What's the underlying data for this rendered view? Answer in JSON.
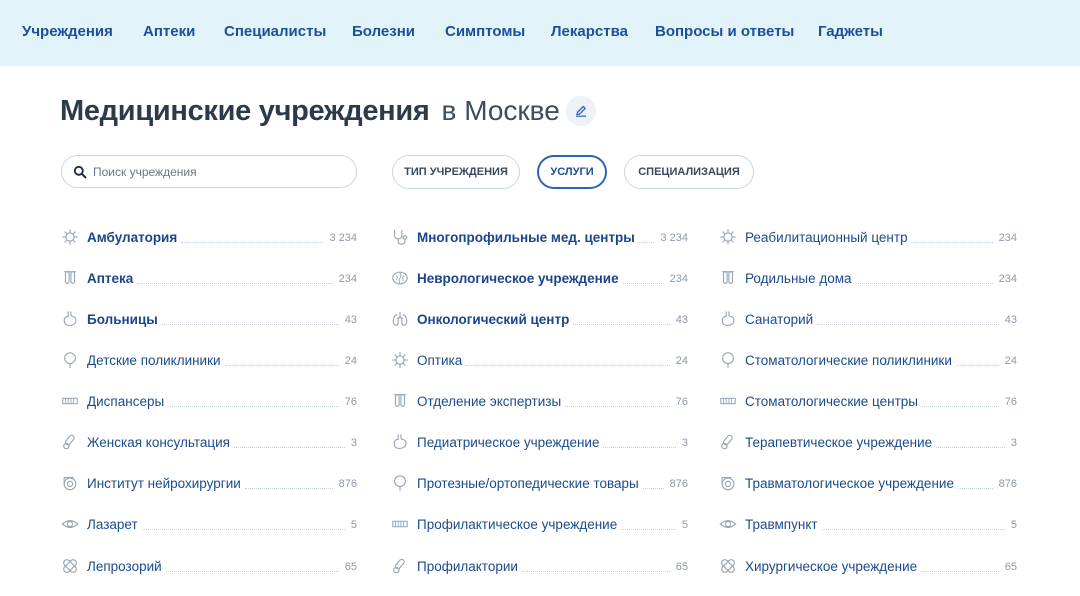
{
  "nav": [
    "Учреждения",
    "Аптеки",
    "Специалисты",
    "Болезни",
    "Симптомы",
    "Лекарства",
    "Вопросы и ответы",
    "Гаджеты"
  ],
  "title": {
    "main": "Медицинские учреждения",
    "city": "в Москве"
  },
  "search": {
    "placeholder": "Поиск учреждения",
    "value": ""
  },
  "filters": [
    {
      "label": "Тип учреждения",
      "active": false
    },
    {
      "label": "Услуги",
      "active": true
    },
    {
      "label": "Специализация",
      "active": false
    }
  ],
  "colors": {
    "nav_bg": "#e2f4fa",
    "accent": "#2d64b8",
    "link": "#1c4b8c",
    "count": "#8c9aa8"
  },
  "columns": [
    [
      {
        "label": "Амбулатория",
        "count": "3 234",
        "bold": true,
        "icon": "virus-icon"
      },
      {
        "label": "Аптека",
        "count": "234",
        "bold": true,
        "icon": "test-tubes-icon"
      },
      {
        "label": "Больницы",
        "count": "43",
        "bold": true,
        "icon": "stomach-icon"
      },
      {
        "label": "Детские поликлиники",
        "count": "24",
        "bold": false,
        "icon": "lollipop-icon"
      },
      {
        "label": "Диспансеры",
        "count": "76",
        "bold": false,
        "icon": "comb-icon"
      },
      {
        "label": "Женская консультация",
        "count": "3",
        "bold": false,
        "icon": "pills-icon"
      },
      {
        "label": "Институт нейрохирургии",
        "count": "876",
        "bold": false,
        "icon": "bandage-roll-icon"
      },
      {
        "label": "Лазарет",
        "count": "5",
        "bold": false,
        "icon": "eye-icon"
      },
      {
        "label": "Лепрозорий",
        "count": "65",
        "bold": false,
        "icon": "bandage-icon"
      }
    ],
    [
      {
        "label": "Многопрофильные мед. центры",
        "count": "3 234",
        "bold": true,
        "icon": "stethoscope-icon"
      },
      {
        "label": "Неврологическое учреждение",
        "count": "234",
        "bold": true,
        "icon": "brain-icon"
      },
      {
        "label": "Онкологический центр",
        "count": "43",
        "bold": true,
        "icon": "lungs-icon"
      },
      {
        "label": "Оптика",
        "count": "24",
        "bold": false,
        "icon": "virus-icon"
      },
      {
        "label": "Отделение экспертизы",
        "count": "76",
        "bold": false,
        "icon": "test-tubes-icon"
      },
      {
        "label": "Педиатрическое учреждение",
        "count": "3",
        "bold": false,
        "icon": "stomach-icon"
      },
      {
        "label": "Протезные/ортопедические товары",
        "count": "876",
        "bold": false,
        "icon": "lollipop-icon"
      },
      {
        "label": "Профилактическое учреждение",
        "count": "5",
        "bold": false,
        "icon": "comb-icon"
      },
      {
        "label": "Профилактории",
        "count": "65",
        "bold": false,
        "icon": "pills-icon"
      }
    ],
    [
      {
        "label": "Реабилитационный центр",
        "count": "234",
        "bold": false,
        "icon": "virus-icon"
      },
      {
        "label": "Родильные дома",
        "count": "234",
        "bold": false,
        "icon": "test-tubes-icon"
      },
      {
        "label": "Санаторий",
        "count": "43",
        "bold": false,
        "icon": "stomach-icon"
      },
      {
        "label": "Стоматологические поликлиники",
        "count": "24",
        "bold": false,
        "icon": "lollipop-icon"
      },
      {
        "label": "Стоматологические центры",
        "count": "76",
        "bold": false,
        "icon": "comb-icon"
      },
      {
        "label": "Терапевтическое учреждение",
        "count": "3",
        "bold": false,
        "icon": "pills-icon"
      },
      {
        "label": "Травматологическое учреждение",
        "count": "876",
        "bold": false,
        "icon": "bandage-roll-icon"
      },
      {
        "label": "Травмпункт",
        "count": "5",
        "bold": false,
        "icon": "eye-icon"
      },
      {
        "label": "Хирургическое учреждение",
        "count": "65",
        "bold": false,
        "icon": "bandage-icon"
      }
    ]
  ]
}
